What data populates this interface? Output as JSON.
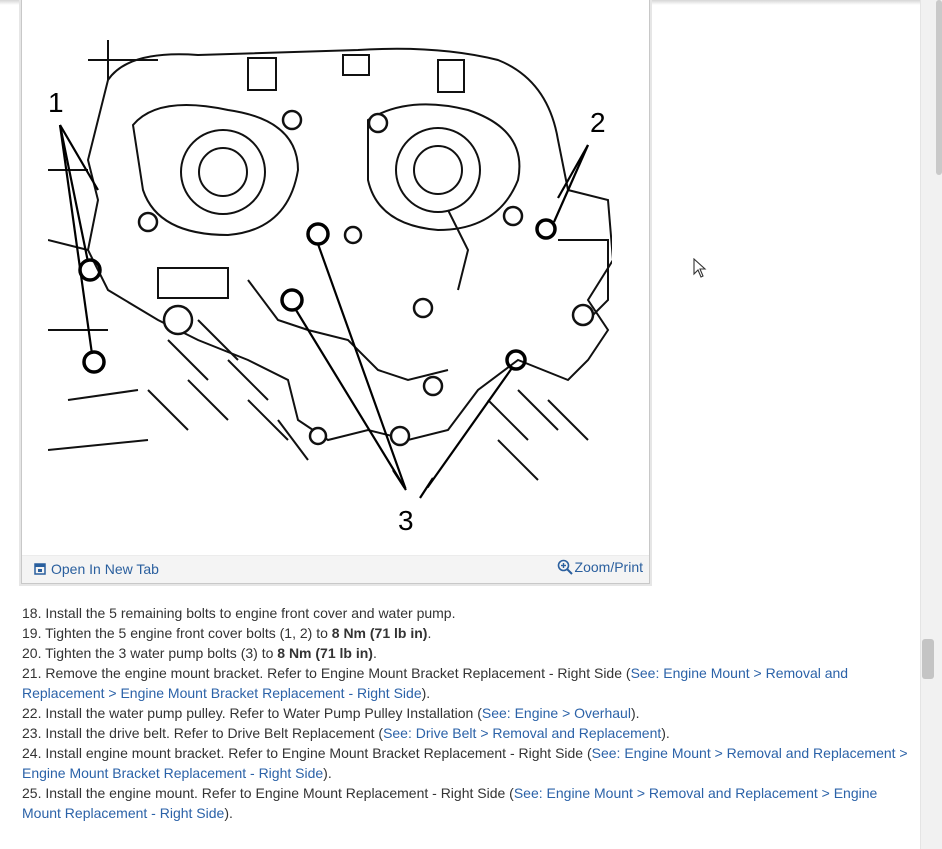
{
  "figure": {
    "callouts": [
      "1",
      "2",
      "3"
    ],
    "open_tab_label": "Open In New Tab",
    "zoom_print_label": "Zoom/Print"
  },
  "steps": [
    {
      "num": "18.",
      "text": "Install the 5 remaining bolts to engine front cover and water pump."
    },
    {
      "num": "19.",
      "text": "Tighten the 5 engine front cover bolts (1, 2) to ",
      "bold": "8 Nm (71 lb in)",
      "after": "."
    },
    {
      "num": "20.",
      "text": "Tighten the 3 water pump bolts (3) to ",
      "bold": "8 Nm (71 lb in)",
      "after": "."
    },
    {
      "num": "21.",
      "text": "Remove the engine mount bracket. Refer to Engine Mount Bracket Replacement - Right Side (",
      "link": "See: Engine Mount > Removal and Replacement > Engine Mount Bracket Replacement - Right Side",
      "after": ")."
    },
    {
      "num": "22.",
      "text": "Install the water pump pulley. Refer to Water Pump Pulley Installation (",
      "link": "See: Engine > Overhaul",
      "after": ")."
    },
    {
      "num": "23.",
      "text": "Install the drive belt. Refer to Drive Belt Replacement (",
      "link": "See: Drive Belt > Removal and Replacement",
      "after": ")."
    },
    {
      "num": "24.",
      "text": "Install engine mount bracket. Refer to Engine Mount Bracket Replacement - Right Side (",
      "link": "See: Engine Mount > Removal and Replacement > Engine Mount Bracket Replacement - Right Side",
      "after": ")."
    },
    {
      "num": "25.",
      "text": "Install the engine mount. Refer to Engine Mount Replacement - Right Side (",
      "link": "See: Engine Mount > Removal and Replacement > Engine Mount Replacement - Right Side",
      "after": ")."
    }
  ],
  "colors": {
    "link": "#2b62a8",
    "text": "#333333",
    "figure_bar": "#f4f4f4"
  }
}
